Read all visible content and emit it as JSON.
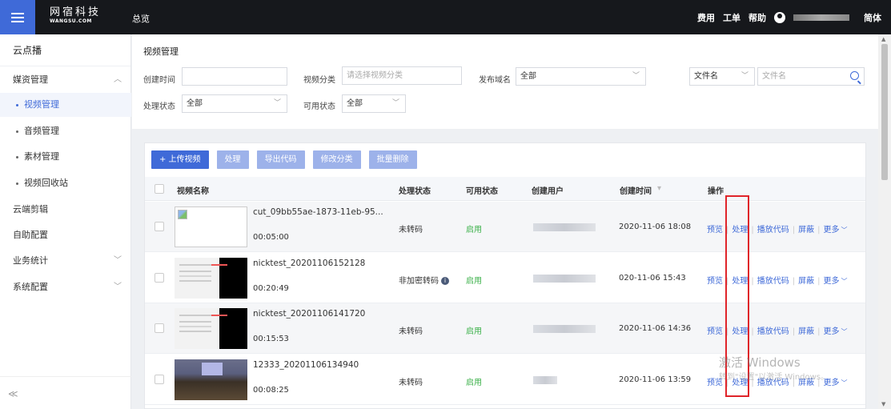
{
  "topbar": {
    "logo_cn": "网宿科技",
    "logo_en": "WANGSU.COM",
    "nav_overview": "总览",
    "fees": "费用",
    "tickets": "工单",
    "help": "帮助",
    "language": "简体"
  },
  "sidebar": {
    "title": "云点播",
    "media": "媒资管理",
    "sub": [
      "视频管理",
      "音频管理",
      "素材管理",
      "视频回收站"
    ],
    "editing": "云端剪辑",
    "auto_config": "自助配置",
    "stats": "业务统计",
    "sys_config": "系统配置",
    "collapse": "≪"
  },
  "filter": {
    "title": "视频管理",
    "created_time_label": "创建时间",
    "category_label": "视频分类",
    "category_placeholder": "请选择视频分类",
    "domain_label": "发布域名",
    "domain_value": "全部",
    "search_type": "文件名",
    "search_placeholder": "文件名",
    "process_status_label": "处理状态",
    "process_status_value": "全部",
    "avail_status_label": "可用状态",
    "avail_status_value": "全部"
  },
  "toolbar": {
    "upload": "+ 上传视频",
    "process": "处理",
    "export": "导出代码",
    "modify_category": "修改分类",
    "batch_delete": "批量删除"
  },
  "table": {
    "headers": {
      "name": "视频名称",
      "process_status": "处理状态",
      "avail_status": "可用状态",
      "creator": "创建用户",
      "created_time": "创建时间",
      "actions": "操作"
    },
    "action_labels": {
      "preview": "预览",
      "process": "处理",
      "play_code": "播放代码",
      "block": "屏蔽",
      "more": "更多"
    },
    "rows": [
      {
        "name": "cut_09bb55ae-1873-11eb-95...",
        "duration": "00:05:00",
        "process_status": "未转码",
        "avail_status": "启用",
        "created_time": "2020-11-06 18:08"
      },
      {
        "name": "nicktest_20201106152128",
        "duration": "00:20:49",
        "process_status": "非加密转码",
        "avail_status": "启用",
        "created_time": "020-11-06 15:43"
      },
      {
        "name": "nicktest_20201106141720",
        "duration": "00:15:53",
        "process_status": "未转码",
        "avail_status": "启用",
        "created_time": "2020-11-06 14:36"
      },
      {
        "name": "12333_20201106134940",
        "duration": "00:08:25",
        "process_status": "未转码",
        "avail_status": "启用",
        "created_time": "2020-11-06 13:59"
      }
    ]
  },
  "watermark": {
    "line1": "激活 Windows",
    "line2": "转到\"设置\"以激活 Windows。"
  },
  "colors": {
    "accent": "#3f6ad8",
    "topbar": "#16181c",
    "enabled": "#3cb14a",
    "highlight": "#e0242a"
  }
}
